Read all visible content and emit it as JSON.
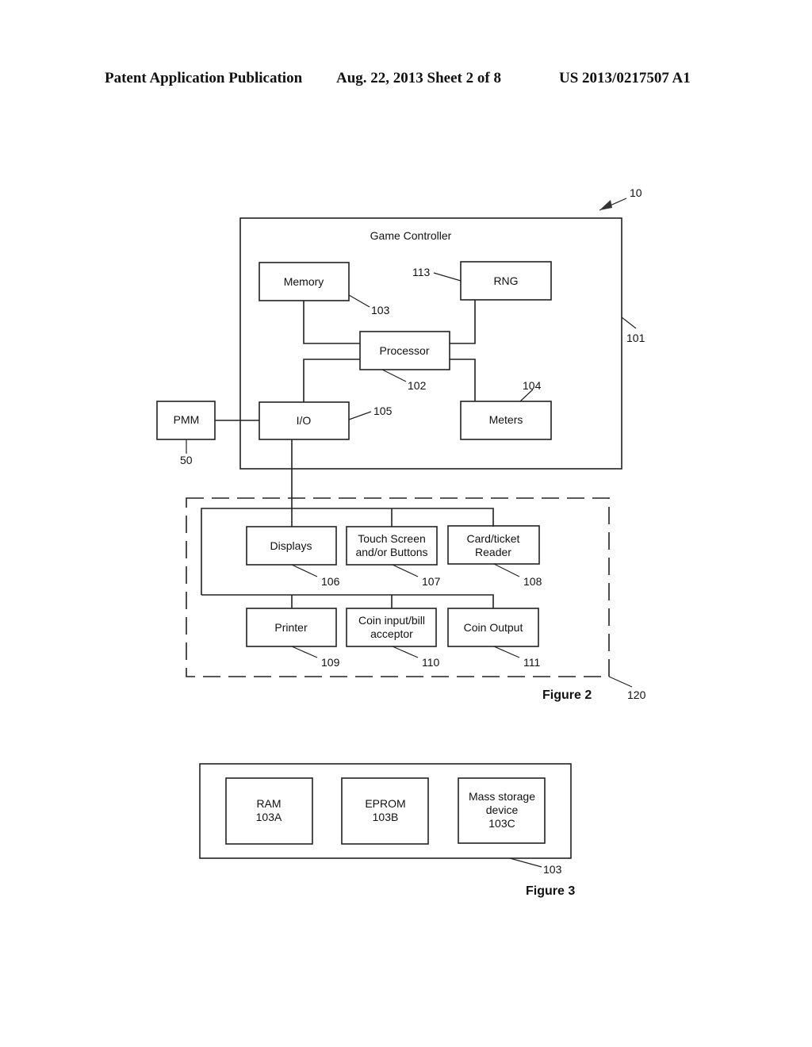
{
  "header": {
    "publication": "Patent Application Publication",
    "date_sheet": "Aug. 22, 2013  Sheet 2 of 8",
    "number": "US 2013/0217507 A1"
  },
  "figure2": {
    "caption": "Figure 2",
    "system_ref": "10",
    "controller": {
      "title": "Game Controller",
      "ref": "101"
    },
    "memory": {
      "label": "Memory",
      "ref": "103"
    },
    "rng": {
      "label": "RNG",
      "ref": "113"
    },
    "processor": {
      "label": "Processor",
      "ref": "102"
    },
    "io": {
      "label": "I/O",
      "ref": "105"
    },
    "meters": {
      "label": "Meters",
      "ref": "104"
    },
    "pmm": {
      "label": "PMM",
      "ref": "50"
    },
    "peripherals_ref": "120",
    "peripherals": [
      {
        "line1": "Displays",
        "line2": "",
        "ref": "106"
      },
      {
        "line1": "Touch Screen",
        "line2": "and/or Buttons",
        "ref": "107"
      },
      {
        "line1": "Card/ticket",
        "line2": "Reader",
        "ref": "108"
      },
      {
        "line1": "Printer",
        "line2": "",
        "ref": "109"
      },
      {
        "line1": "Coin input/bill",
        "line2": "acceptor",
        "ref": "110"
      },
      {
        "line1": "Coin Output",
        "line2": "",
        "ref": "111"
      }
    ]
  },
  "figure3": {
    "caption": "Figure 3",
    "ref": "103",
    "items": [
      {
        "lines": [
          "RAM",
          "103A"
        ]
      },
      {
        "lines": [
          "EPROM",
          "103B"
        ]
      },
      {
        "lines": [
          "Mass storage",
          "device",
          "103C"
        ]
      }
    ]
  }
}
